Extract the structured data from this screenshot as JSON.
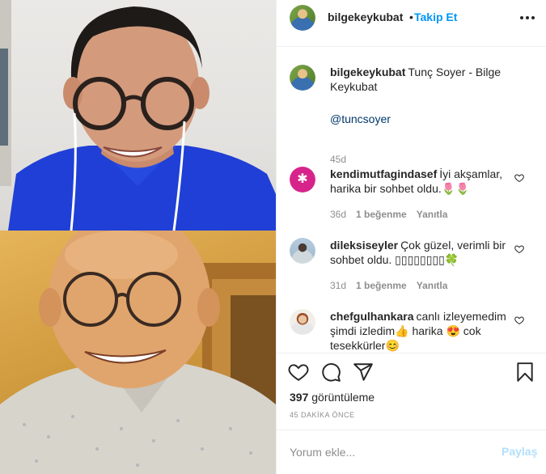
{
  "header": {
    "username": "bilgekeykubat",
    "separator": "•",
    "follow_label": "Takip Et",
    "more_icon": "more-horizontal-icon"
  },
  "caption": {
    "username": "bilgekeykubat",
    "text_line1": "Tunç Soyer - Bilge",
    "text_line2": "Keykubat",
    "mention": "@tuncsoyer",
    "age": "45d"
  },
  "comments": [
    {
      "username": "kendimutfagindasef",
      "text": "İyi akşamlar, harika bir sohbet oldu.🌷🌷",
      "age": "36d",
      "likes": "1 beğenme",
      "reply": "Yanıtla"
    },
    {
      "username": "dileksiseyler",
      "text": "Çok güzel, verimli bir sohbet oldu. ▯▯▯▯▯▯▯▯🍀",
      "age": "31d",
      "likes": "1 beğenme",
      "reply": "Yanıtla"
    },
    {
      "username": "chefgulhankara",
      "text": "canlı izleyemedim şimdi izledim👍 harika 😍 cok tesekkürler😊"
    }
  ],
  "actions": {
    "like_icon": "heart-icon",
    "comment_icon": "comment-icon",
    "share_icon": "paper-plane-icon",
    "save_icon": "bookmark-icon",
    "views_count": "397",
    "views_label": "görüntüleme",
    "time_ago": "45 DAKİKA ÖNCE"
  },
  "comment_box": {
    "placeholder": "Yorum ekle...",
    "share_label": "Paylaş"
  },
  "colors": {
    "link_blue": "#0095f6",
    "share_disabled": "#b2dffc",
    "muted": "#8e8e8e",
    "text": "#262626"
  }
}
